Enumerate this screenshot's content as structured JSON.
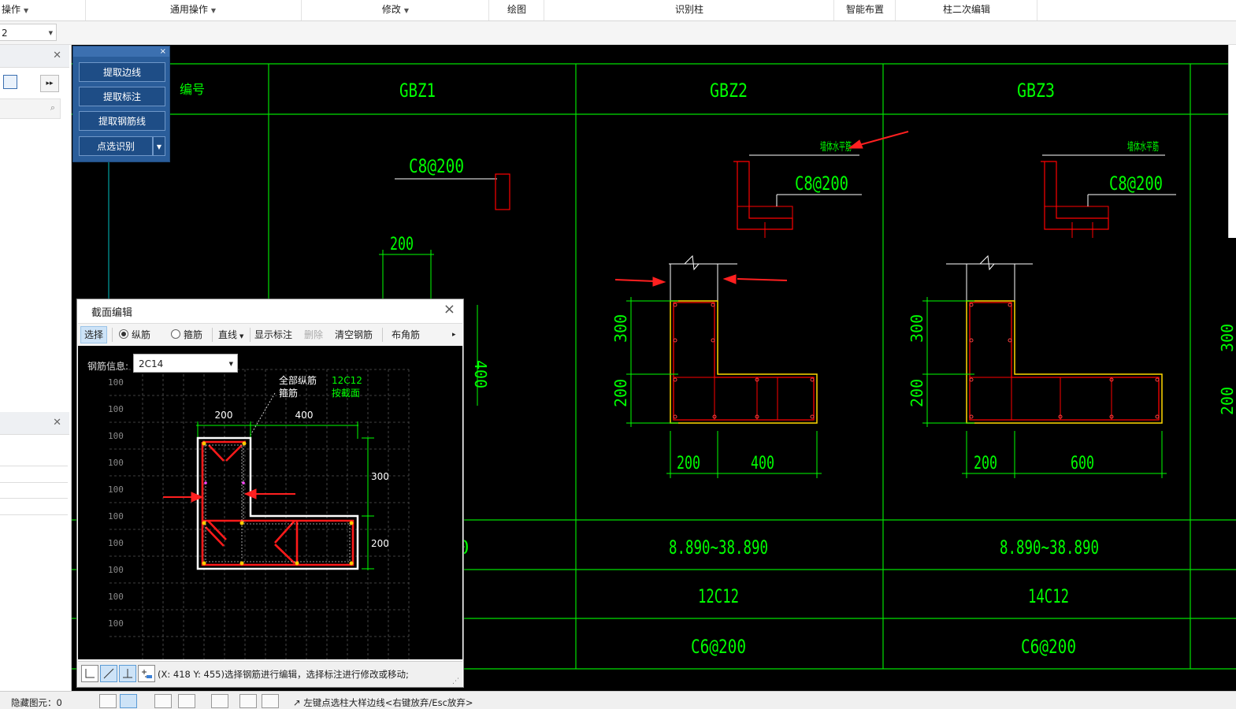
{
  "ribbon": {
    "groups": [
      "操作",
      "通用操作",
      "修改",
      "绘图",
      "识别柱",
      "智能布置",
      "柱二次编辑"
    ]
  },
  "toolbar2": {
    "floor_value": "2"
  },
  "extract_panel": {
    "close": "×",
    "buttons": [
      "提取边线",
      "提取标注",
      "提取钢筋线",
      "点选识别"
    ]
  },
  "drawing": {
    "row_label": "编号",
    "columns": [
      {
        "name": "GBZ1",
        "top_stirrup": "C8@200",
        "dim_width": "200",
        "dim_side": "400",
        "elevation": "",
        "longitudinal": "",
        "stirrup": ""
      },
      {
        "name": "GBZ2",
        "wall_note": "墙体水平筋",
        "top_stirrup": "C8@200",
        "dims": {
          "h1": "300",
          "h2": "200",
          "w1": "200",
          "w2": "400"
        },
        "elevation": "8.890~38.890",
        "longitudinal": "12C12",
        "stirrup": "C6@200"
      },
      {
        "name": "GBZ3",
        "wall_note": "墙体水平筋",
        "top_stirrup": "C8@200",
        "dims": {
          "h1": "300",
          "h2": "200",
          "w1": "200",
          "w2": "600"
        },
        "elevation": "8.890~38.890",
        "longitudinal": "14C12",
        "stirrup": "C6@200"
      }
    ],
    "partial_col4": {
      "h1": "300",
      "h2": "200"
    },
    "partial_elev_tail": "0"
  },
  "dialog": {
    "title": "截面编辑",
    "close": "×",
    "toolbar": {
      "select": "选择",
      "radio_long": "纵筋",
      "radio_stirrup": "箍筋",
      "line": "直线",
      "show_label": "显示标注",
      "delete": "删除",
      "clear": "清空钢筋",
      "corner": "布角筋",
      "more": "▸"
    },
    "rebar_info_label": "钢筋信息:",
    "rebar_info_value": "2C14",
    "legend_all": "全部纵筋",
    "legend_stirrup": "箍筋",
    "legend_value": "12C12",
    "legend_by": "按截面",
    "dims": {
      "w1": "200",
      "w2": "400",
      "h1": "300",
      "h2": "200"
    },
    "grid_labels": [
      "100",
      "100",
      "100",
      "100",
      "100",
      "100",
      "100",
      "100",
      "100",
      "100"
    ],
    "coord_text": "(X: 418 Y: 455)选择钢筋进行编辑，选择标注进行修改或移动;"
  },
  "statusbar": {
    "hidden": "隐藏图元：0",
    "hint": "左键点选柱大样边线<右键放弃/Esc放弃>"
  },
  "colors": {
    "cad_bg": "#000000",
    "cad_green": "#00ff00",
    "cad_red": "#ff0000",
    "cad_yellow": "#ffd700",
    "cad_cyan": "#00c0c0",
    "arrow_red": "#ff2020",
    "panel_blue": "#2a5d9a"
  }
}
